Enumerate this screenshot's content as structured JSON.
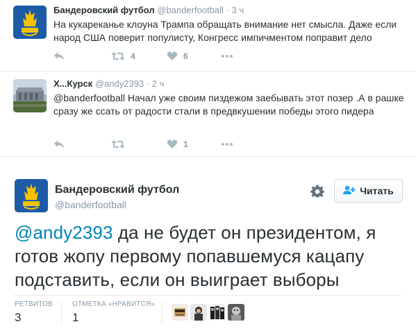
{
  "tweet1": {
    "name": "Бандеровский футбол",
    "handle": "@banderfootball",
    "dot": "·",
    "time": "3 ч",
    "text": "На кукареканье клоуна Трампа обращать внимание нет смысла. Даже если народ США поверит популисту, Конгресс импичментом поправит дело",
    "retweets": "4",
    "likes": "6"
  },
  "tweet2": {
    "name": "Х...Курск",
    "handle": "@andy2393",
    "dot": "·",
    "time": "2 ч",
    "mention": "@banderfootball",
    "text": " Начал уже своим пиздежом заебывать этот позер .А в рашке сразу же ссать от радости стали в предвкушении победы этого пидера",
    "likes": "1"
  },
  "main_tweet": {
    "name": "Бандеровский футбол",
    "handle": "@banderfootball",
    "follow_label": "Читать",
    "mention": "@andy2393",
    "text": " да не будет он президентом, я готов жопу первому попавшемуся кацапу подставить, если он выиграет выборы",
    "retweets_label": "РЕТВИТОВ",
    "retweets_count": "3",
    "likes_label": "ОТМЕТКА «НРАВИТСЯ»",
    "likes_count": "1"
  },
  "avatar_badge_text": "УКРАЇНА",
  "colors": {
    "brand_blue": "#1d5ba6",
    "brand_yellow": "#f5c400",
    "mention": "#0084b4",
    "muted": "#8899a6",
    "icon": "#aab8c2"
  },
  "icons": [
    "reply-icon",
    "retweet-icon",
    "heart-icon",
    "more-icon",
    "gear-icon",
    "follow-person-icon"
  ]
}
